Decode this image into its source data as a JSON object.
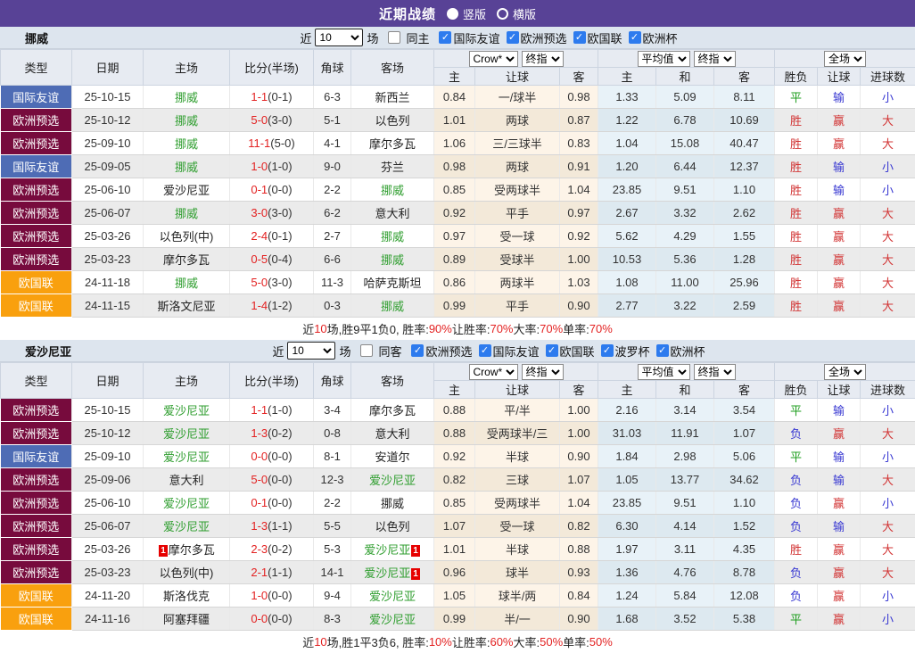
{
  "topbar": {
    "title": "近期战绩",
    "radios": [
      {
        "label": "竖版",
        "selected": true
      },
      {
        "label": "横版",
        "selected": false
      }
    ]
  },
  "colors": {
    "topbar_bg": "#584296",
    "type_colors": {
      "国际友谊": "#4e6cb5",
      "欧洲预选": "#770b3d",
      "欧国联": "#f9a00e"
    },
    "focus_team": "#2f9e2f",
    "score_red": "#e32222",
    "result_map": {
      "胜": "#d23434",
      "平": "#1e9e1e",
      "负": "#3939d2",
      "赢": "#d23434",
      "输": "#3939d2",
      "大": "#d23434",
      "小": "#3939d2"
    },
    "checkbox_blue": "#2d7bee"
  },
  "table_header": {
    "left_cols": [
      "类型",
      "日期",
      "主场",
      "比分(半场)",
      "角球",
      "客场"
    ],
    "odds_selects": [
      "Crow*",
      "终指"
    ],
    "avg_selects": [
      "平均值",
      "终指"
    ],
    "result_select": "全场",
    "odds_cols": [
      "主",
      "让球",
      "客"
    ],
    "avg_cols": [
      "主",
      "和",
      "客"
    ],
    "result_cols": [
      "胜负",
      "让球",
      "进球数"
    ]
  },
  "sections": [
    {
      "team": "挪威",
      "toolbar": {
        "recent_label": "近",
        "count": "10",
        "field_label": "场",
        "same_label": "同主",
        "same_checked": false,
        "filters": [
          {
            "label": "国际友谊",
            "checked": true
          },
          {
            "label": "欧洲预选",
            "checked": true
          },
          {
            "label": "欧国联",
            "checked": true
          },
          {
            "label": "欧洲杯",
            "checked": true
          }
        ]
      },
      "rows": [
        {
          "type": "国际友谊",
          "date": "25-10-15",
          "home": "挪威",
          "home_focus": true,
          "score": "1-1",
          "half": "(0-1)",
          "corner": "6-3",
          "away": "新西兰",
          "away_focus": false,
          "odds": [
            "0.84",
            "一/球半",
            "0.98"
          ],
          "avg": [
            "1.33",
            "5.09",
            "8.11"
          ],
          "res": [
            "平",
            "输",
            "小"
          ]
        },
        {
          "type": "欧洲预选",
          "date": "25-10-12",
          "home": "挪威",
          "home_focus": true,
          "score": "5-0",
          "half": "(3-0)",
          "corner": "5-1",
          "away": "以色列",
          "away_focus": false,
          "odds": [
            "1.01",
            "两球",
            "0.87"
          ],
          "avg": [
            "1.22",
            "6.78",
            "10.69"
          ],
          "res": [
            "胜",
            "赢",
            "大"
          ]
        },
        {
          "type": "欧洲预选",
          "date": "25-09-10",
          "home": "挪威",
          "home_focus": true,
          "score": "11-1",
          "half": "(5-0)",
          "corner": "4-1",
          "away": "摩尔多瓦",
          "away_focus": false,
          "odds": [
            "1.06",
            "三/三球半",
            "0.83"
          ],
          "avg": [
            "1.04",
            "15.08",
            "40.47"
          ],
          "res": [
            "胜",
            "赢",
            "大"
          ]
        },
        {
          "type": "国际友谊",
          "date": "25-09-05",
          "home": "挪威",
          "home_focus": true,
          "score": "1-0",
          "half": "(1-0)",
          "corner": "9-0",
          "away": "芬兰",
          "away_focus": false,
          "odds": [
            "0.98",
            "两球",
            "0.91"
          ],
          "avg": [
            "1.20",
            "6.44",
            "12.37"
          ],
          "res": [
            "胜",
            "输",
            "小"
          ]
        },
        {
          "type": "欧洲预选",
          "date": "25-06-10",
          "home": "爱沙尼亚",
          "home_focus": false,
          "score": "0-1",
          "half": "(0-0)",
          "corner": "2-2",
          "away": "挪威",
          "away_focus": true,
          "odds": [
            "0.85",
            "受两球半",
            "1.04"
          ],
          "avg": [
            "23.85",
            "9.51",
            "1.10"
          ],
          "res": [
            "胜",
            "输",
            "小"
          ]
        },
        {
          "type": "欧洲预选",
          "date": "25-06-07",
          "home": "挪威",
          "home_focus": true,
          "score": "3-0",
          "half": "(3-0)",
          "corner": "6-2",
          "away": "意大利",
          "away_focus": false,
          "odds": [
            "0.92",
            "平手",
            "0.97"
          ],
          "avg": [
            "2.67",
            "3.32",
            "2.62"
          ],
          "res": [
            "胜",
            "赢",
            "大"
          ]
        },
        {
          "type": "欧洲预选",
          "date": "25-03-26",
          "home": "以色列(中)",
          "home_focus": false,
          "score": "2-4",
          "half": "(0-1)",
          "corner": "2-7",
          "away": "挪威",
          "away_focus": true,
          "odds": [
            "0.97",
            "受一球",
            "0.92"
          ],
          "avg": [
            "5.62",
            "4.29",
            "1.55"
          ],
          "res": [
            "胜",
            "赢",
            "大"
          ]
        },
        {
          "type": "欧洲预选",
          "date": "25-03-23",
          "home": "摩尔多瓦",
          "home_focus": false,
          "score": "0-5",
          "half": "(0-4)",
          "corner": "6-6",
          "away": "挪威",
          "away_focus": true,
          "odds": [
            "0.89",
            "受球半",
            "1.00"
          ],
          "avg": [
            "10.53",
            "5.36",
            "1.28"
          ],
          "res": [
            "胜",
            "赢",
            "大"
          ]
        },
        {
          "type": "欧国联",
          "date": "24-11-18",
          "home": "挪威",
          "home_focus": true,
          "score": "5-0",
          "half": "(3-0)",
          "corner": "11-3",
          "away": "哈萨克斯坦",
          "away_focus": false,
          "odds": [
            "0.86",
            "两球半",
            "1.03"
          ],
          "avg": [
            "1.08",
            "11.00",
            "25.96"
          ],
          "res": [
            "胜",
            "赢",
            "大"
          ]
        },
        {
          "type": "欧国联",
          "date": "24-11-15",
          "home": "斯洛文尼亚",
          "home_focus": false,
          "score": "1-4",
          "half": "(1-2)",
          "corner": "0-3",
          "away": "挪威",
          "away_focus": true,
          "odds": [
            "0.99",
            "平手",
            "0.90"
          ],
          "avg": [
            "2.77",
            "3.22",
            "2.59"
          ],
          "res": [
            "胜",
            "赢",
            "大"
          ]
        }
      ],
      "summary": [
        {
          "text": "近",
          "red": false
        },
        {
          "text": "10",
          "red": true
        },
        {
          "text": "场,胜9平1负0, 胜率:",
          "red": false
        },
        {
          "text": "90%",
          "red": true
        },
        {
          "text": " 让胜率:",
          "red": false
        },
        {
          "text": "70%",
          "red": true
        },
        {
          "text": " 大率:",
          "red": false
        },
        {
          "text": "70%",
          "red": true
        },
        {
          "text": " 单率:",
          "red": false
        },
        {
          "text": "70%",
          "red": true
        }
      ]
    },
    {
      "team": "爱沙尼亚",
      "toolbar": {
        "recent_label": "近",
        "count": "10",
        "field_label": "场",
        "same_label": "同客",
        "same_checked": false,
        "filters": [
          {
            "label": "欧洲预选",
            "checked": true
          },
          {
            "label": "国际友谊",
            "checked": true
          },
          {
            "label": "欧国联",
            "checked": true
          },
          {
            "label": "波罗杯",
            "checked": true
          },
          {
            "label": "欧洲杯",
            "checked": true
          }
        ]
      },
      "rows": [
        {
          "type": "欧洲预选",
          "date": "25-10-15",
          "home": "爱沙尼亚",
          "home_focus": true,
          "score": "1-1",
          "half": "(1-0)",
          "corner": "3-4",
          "away": "摩尔多瓦",
          "away_focus": false,
          "odds": [
            "0.88",
            "平/半",
            "1.00"
          ],
          "avg": [
            "2.16",
            "3.14",
            "3.54"
          ],
          "res": [
            "平",
            "输",
            "小"
          ]
        },
        {
          "type": "欧洲预选",
          "date": "25-10-12",
          "home": "爱沙尼亚",
          "home_focus": true,
          "score": "1-3",
          "half": "(0-2)",
          "corner": "0-8",
          "away": "意大利",
          "away_focus": false,
          "odds": [
            "0.88",
            "受两球半/三",
            "1.00"
          ],
          "avg": [
            "31.03",
            "11.91",
            "1.07"
          ],
          "res": [
            "负",
            "赢",
            "大"
          ]
        },
        {
          "type": "国际友谊",
          "date": "25-09-10",
          "home": "爱沙尼亚",
          "home_focus": true,
          "score": "0-0",
          "half": "(0-0)",
          "corner": "8-1",
          "away": "安道尔",
          "away_focus": false,
          "odds": [
            "0.92",
            "半球",
            "0.90"
          ],
          "avg": [
            "1.84",
            "2.98",
            "5.06"
          ],
          "res": [
            "平",
            "输",
            "小"
          ]
        },
        {
          "type": "欧洲预选",
          "date": "25-09-06",
          "home": "意大利",
          "home_focus": false,
          "score": "5-0",
          "half": "(0-0)",
          "corner": "12-3",
          "away": "爱沙尼亚",
          "away_focus": true,
          "odds": [
            "0.82",
            "三球",
            "1.07"
          ],
          "avg": [
            "1.05",
            "13.77",
            "34.62"
          ],
          "res": [
            "负",
            "输",
            "大"
          ]
        },
        {
          "type": "欧洲预选",
          "date": "25-06-10",
          "home": "爱沙尼亚",
          "home_focus": true,
          "score": "0-1",
          "half": "(0-0)",
          "corner": "2-2",
          "away": "挪威",
          "away_focus": false,
          "odds": [
            "0.85",
            "受两球半",
            "1.04"
          ],
          "avg": [
            "23.85",
            "9.51",
            "1.10"
          ],
          "res": [
            "负",
            "赢",
            "小"
          ]
        },
        {
          "type": "欧洲预选",
          "date": "25-06-07",
          "home": "爱沙尼亚",
          "home_focus": true,
          "score": "1-3",
          "half": "(1-1)",
          "corner": "5-5",
          "away": "以色列",
          "away_focus": false,
          "odds": [
            "1.07",
            "受一球",
            "0.82"
          ],
          "avg": [
            "6.30",
            "4.14",
            "1.52"
          ],
          "res": [
            "负",
            "输",
            "大"
          ]
        },
        {
          "type": "欧洲预选",
          "date": "25-03-26",
          "home": "摩尔多瓦",
          "home_focus": false,
          "home_badge": "1",
          "score": "2-3",
          "half": "(0-2)",
          "corner": "5-3",
          "away": "爱沙尼亚",
          "away_focus": true,
          "away_badge": "1",
          "odds": [
            "1.01",
            "半球",
            "0.88"
          ],
          "avg": [
            "1.97",
            "3.11",
            "4.35"
          ],
          "res": [
            "胜",
            "赢",
            "大"
          ]
        },
        {
          "type": "欧洲预选",
          "date": "25-03-23",
          "home": "以色列(中)",
          "home_focus": false,
          "score": "2-1",
          "half": "(1-1)",
          "corner": "14-1",
          "away": "爱沙尼亚",
          "away_focus": true,
          "away_badge": "1",
          "odds": [
            "0.96",
            "球半",
            "0.93"
          ],
          "avg": [
            "1.36",
            "4.76",
            "8.78"
          ],
          "res": [
            "负",
            "赢",
            "大"
          ]
        },
        {
          "type": "欧国联",
          "date": "24-11-20",
          "home": "斯洛伐克",
          "home_focus": false,
          "score": "1-0",
          "half": "(0-0)",
          "corner": "9-4",
          "away": "爱沙尼亚",
          "away_focus": true,
          "odds": [
            "1.05",
            "球半/两",
            "0.84"
          ],
          "avg": [
            "1.24",
            "5.84",
            "12.08"
          ],
          "res": [
            "负",
            "赢",
            "小"
          ]
        },
        {
          "type": "欧国联",
          "date": "24-11-16",
          "home": "阿塞拜疆",
          "home_focus": false,
          "score": "0-0",
          "half": "(0-0)",
          "corner": "8-3",
          "away": "爱沙尼亚",
          "away_focus": true,
          "odds": [
            "0.99",
            "半/一",
            "0.90"
          ],
          "avg": [
            "1.68",
            "3.52",
            "5.38"
          ],
          "res": [
            "平",
            "赢",
            "小"
          ]
        }
      ],
      "summary": [
        {
          "text": "近",
          "red": false
        },
        {
          "text": "10",
          "red": true
        },
        {
          "text": "场,胜1平3负6, 胜率:",
          "red": false
        },
        {
          "text": "10%",
          "red": true
        },
        {
          "text": " 让胜率:",
          "red": false
        },
        {
          "text": "60%",
          "red": true
        },
        {
          "text": " 大率:",
          "red": false
        },
        {
          "text": "50%",
          "red": true
        },
        {
          "text": " 单率:",
          "red": false
        },
        {
          "text": "50%",
          "red": true
        }
      ]
    }
  ]
}
